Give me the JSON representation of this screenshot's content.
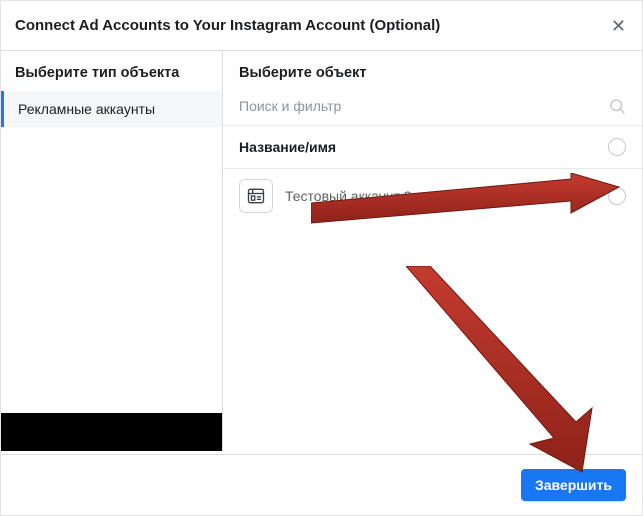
{
  "header": {
    "title": "Connect Ad Accounts to Your Instagram Account (Optional)"
  },
  "sidebar": {
    "title": "Выберите тип объекта",
    "items": [
      {
        "label": "Рекламные аккаунты"
      }
    ]
  },
  "main": {
    "title": "Выберите объект",
    "search_placeholder": "Поиск и фильтр",
    "column_header": "Название/имя",
    "rows": [
      {
        "label": "Тестовый аккаунт 2"
      }
    ]
  },
  "footer": {
    "finish_label": "Завершить"
  }
}
